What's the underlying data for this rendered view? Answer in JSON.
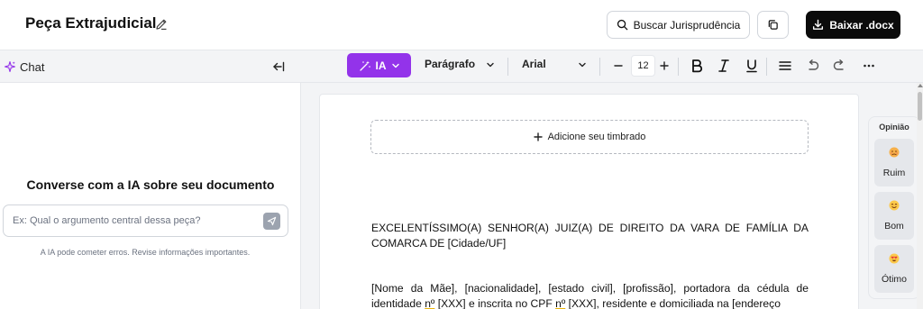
{
  "header": {
    "title": "Peça Extrajudicial",
    "search_label": "Buscar Jurisprudência",
    "download_label": "Baixar .docx"
  },
  "chat": {
    "label": "Chat",
    "heading": "Converse com a IA sobre seu documento",
    "input_placeholder": "Ex: Qual o argumento central dessa peça?",
    "disclaimer": "A IA pode cometer erros. Revise informações importantes."
  },
  "toolbar": {
    "ia_label": "IA",
    "paragraph_style": "Parágrafo",
    "font_family": "Arial",
    "font_size": "12"
  },
  "document": {
    "letterhead_label": "Adicione seu timbrado",
    "paragraph1": "EXCELENTÍSSIMO(A) SENHOR(A) JUIZ(A) DE DIREITO DA VARA DE FAMÍLIA DA COMARCA DE [Cidade/UF]",
    "p2_part1": "[Nome da Mãe], [nacionalidade], [estado civil], [profissão], portadora da cédula de identidade ",
    "p2_ordinal1": "nº",
    "p2_part2": " [XXX] e inscrita no CPF ",
    "p2_ordinal2": "nº",
    "p2_part3": " [XXX], residente e domiciliada na [endereço"
  },
  "opinion": {
    "title": "Opinião",
    "options": [
      {
        "label": "Ruim"
      },
      {
        "label": "Bom"
      },
      {
        "label": "Ótimo"
      }
    ]
  },
  "colors": {
    "accent": "#9333ea",
    "primary_button": "#0b0b0b"
  }
}
